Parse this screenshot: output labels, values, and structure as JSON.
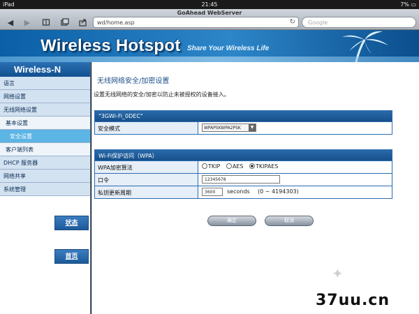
{
  "status_bar": {
    "device": "iPad",
    "time": "21:45",
    "battery": "7%"
  },
  "browser": {
    "page_title": "GoAhead WebServer",
    "url": "wd/home.asp",
    "search_placeholder": "Google"
  },
  "banner": {
    "brand": "Wireless Hotspot",
    "tagline": "Share Your Wireless Life"
  },
  "sidebar": {
    "title": "Wireless-N",
    "items": [
      {
        "label": "语言",
        "level": 0,
        "active": false
      },
      {
        "label": "网络设置",
        "level": 0,
        "active": false
      },
      {
        "label": "无线网络设置",
        "level": 0,
        "active": false
      },
      {
        "label": "基本设置",
        "level": 1,
        "active": false
      },
      {
        "label": "安全设置",
        "level": 2,
        "active": true
      },
      {
        "label": "客户端列表",
        "level": 1,
        "active": false
      },
      {
        "label": "DHCP 服务器",
        "level": 0,
        "active": false
      },
      {
        "label": "网络共享",
        "level": 0,
        "active": false
      },
      {
        "label": "系统管理",
        "level": 0,
        "active": false
      }
    ],
    "status_button": "状态",
    "home_button": "首页"
  },
  "main": {
    "heading": "无线网络安全/加密设置",
    "description": "设置无线网络的安全/加密以防止未被授权的设备接入。",
    "ssid_panel": {
      "title": "\"3GWi-Fi_0DEC\"",
      "security_mode_label": "安全模式",
      "security_mode_value": "WPAPSKWPA2PSK"
    },
    "wpa_panel": {
      "title": "Wi-Fi保护访问（WPA）",
      "algorithm_label": "WPA加密算法",
      "algorithms": [
        {
          "label": "TKIP",
          "selected": false
        },
        {
          "label": "AES",
          "selected": false
        },
        {
          "label": "TKIPAES",
          "selected": true
        }
      ],
      "passphrase_label": "口令",
      "passphrase_value": "12345678",
      "renewal_label": "私钥更新周期",
      "renewal_value": "3600",
      "renewal_unit": "seconds",
      "renewal_range": "(0 ~ 4194303)"
    },
    "ok_button": "确定",
    "cancel_button": "取消"
  },
  "watermark": {
    "text": "37uu.cn"
  },
  "icons": {
    "back": "back-arrow-icon",
    "forward": "forward-arrow-icon",
    "bookmarks": "bookmarks-icon",
    "tabs": "tabs-icon",
    "share": "share-icon",
    "reload": "reload-icon",
    "battery": "battery-icon"
  }
}
